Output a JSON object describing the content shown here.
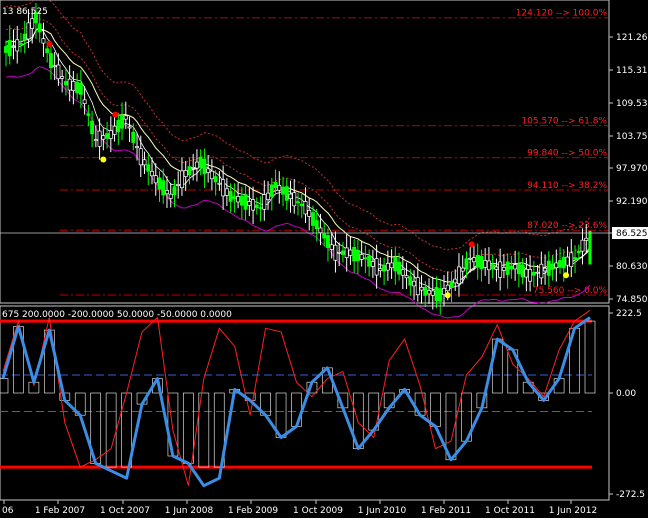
{
  "header": {
    "symbol_info": "13 86.525",
    "indicator_info": "675 200.0000 -200.0000 50.0000 -50.0000 0.0000"
  },
  "colors": {
    "background": "#000000",
    "frame": "#c8c8c8",
    "fib_line": "#c00000",
    "fib_text": "#ff2020",
    "bull_candle": "#00ff00",
    "bear_candle": "#ffffff",
    "ma_yellow": "#ffffbb",
    "ma_red_dotted": "#c03030",
    "band_magenta": "#c000c0",
    "cci_blue": "#3a8ee6",
    "cci_red": "#ff2020",
    "level_dashed": "#3a5fd6",
    "level_solid": "#ff0000",
    "marker_red": "#ff0000",
    "marker_yellow": "#ffff00"
  },
  "price_panel": {
    "current_price": "86.525",
    "current_price_value": 86.525,
    "y_ticks": [
      "121.260",
      "115.310",
      "109.530",
      "103.750",
      "97.970",
      "92.190",
      "86.525",
      "80.630",
      "74.850"
    ],
    "y_tick_values": [
      121.26,
      115.31,
      109.53,
      103.75,
      97.97,
      92.19,
      86.525,
      80.63,
      74.85
    ],
    "fib_levels": [
      {
        "label": "124.120 --> 100.0%",
        "value": 124.12
      },
      {
        "label": "105.570 --> 61.8%",
        "value": 105.57
      },
      {
        "label": "99.840 --> 50.0%",
        "value": 99.84
      },
      {
        "label": "94.110 --> 38.2%",
        "value": 94.11
      },
      {
        "label": "87.020 --> 23.6%",
        "value": 87.02
      },
      {
        "label": "75.560 --> 0.0%",
        "value": 75.56
      }
    ]
  },
  "indicator_panel": {
    "y_ticks": [
      "222.5",
      "0.00",
      "-272.5"
    ],
    "y_tick_values": [
      222.5,
      0,
      -272.5
    ],
    "levels_solid": [
      200,
      -200
    ],
    "levels_dashed": [
      50,
      -50
    ]
  },
  "x_axis": {
    "labels": [
      "06",
      "1 Feb 2007",
      "1 Oct 2007",
      "1 Jun 2008",
      "1 Feb 2009",
      "1 Oct 2009",
      "1 Jun 2010",
      "1 Feb 2011",
      "1 Oct 2011",
      "1 Jun 2012"
    ]
  },
  "chart_data": {
    "type": "line",
    "x": [
      "2006-06",
      "2007-02",
      "2007-10",
      "2008-06",
      "2009-02",
      "2009-10",
      "2010-06",
      "2011-02",
      "2011-10",
      "2012-06"
    ],
    "price_series": [
      {
        "values": [
          119,
          120,
          124.12,
          117,
          113,
          112,
          103,
          104,
          107,
          100,
          96,
          93,
          97,
          99,
          96,
          93,
          92,
          91,
          95,
          93,
          91,
          87,
          83,
          83,
          82,
          80,
          81,
          78,
          76.2,
          75.56,
          78,
          82,
          81,
          80,
          80.5,
          79,
          80,
          81,
          82,
          86.525
        ]
      }
    ],
    "indicator_series": [
      {
        "values": [
          40,
          185,
          30,
          175,
          -20,
          -60,
          -190,
          -210,
          -230,
          -30,
          40,
          -170,
          -190,
          -250,
          -230,
          10,
          -20,
          -60,
          -120,
          -90,
          30,
          70,
          -40,
          -150,
          -100,
          -40,
          10,
          -60,
          -90,
          -180,
          -130,
          -40,
          150,
          120,
          30,
          -20,
          40,
          180,
          210
        ]
      },
      {
        "values": [
          60,
          200,
          20,
          210,
          -80,
          -200,
          -180,
          -150,
          0,
          170,
          210,
          -100,
          -250,
          40,
          180,
          130,
          -60,
          180,
          170,
          30,
          -10,
          40,
          60,
          -80,
          -120,
          90,
          150,
          20,
          -150,
          -130,
          50,
          100,
          190,
          80,
          40,
          -10,
          120,
          200,
          230
        ]
      }
    ]
  }
}
